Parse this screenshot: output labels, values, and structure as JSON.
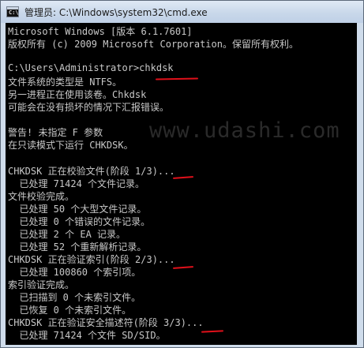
{
  "window": {
    "title": "管理员: C:\\Windows\\system32\\cmd.exe",
    "icon": "cmd-app-icon",
    "icon_prompt": "C:\\"
  },
  "console": {
    "lines": [
      "Microsoft Windows [版本 6.1.7601]",
      "版权所有 (c) 2009 Microsoft Corporation。保留所有权利。",
      "",
      "C:\\Users\\Administrator>",
      "文件系统的类型是 NTFS。",
      "另一进程正在使用该卷。Chkdsk",
      "可能会在没有损坏的情况下汇报错误。",
      "",
      "警告! 未指定 F 参数",
      "在只读模式下运行 CHKDSK。",
      "",
      "CHKDSK 正在校验文件(阶段 1/3)...",
      "  已处理 71424 个文件记录。",
      "文件校验完成。",
      "  已处理 50 个大型文件记录。",
      "  已处理 0 个错误的文件记录。",
      "  已处理 2 个 EA 记录。",
      "  已处理 52 个重新解析记录。",
      "CHKDSK 正在验证索引(阶段 2/3)...",
      "  已处理 100860 个索引项。",
      "索引验证完成。",
      "  已扫描到 0 个未索引文件。",
      "  已恢复 0 个未索引文件。",
      "CHKDSK 正在验证安全描述符(阶段 3/3)...",
      "  已处理 71424 个文件 SD/SID。"
    ],
    "typed_command": "chkdsk",
    "watermark": "www.udashi.com"
  },
  "colors": {
    "console_bg": "#000000",
    "console_text": "#c8c8c8",
    "annotation": "#e0101a"
  }
}
